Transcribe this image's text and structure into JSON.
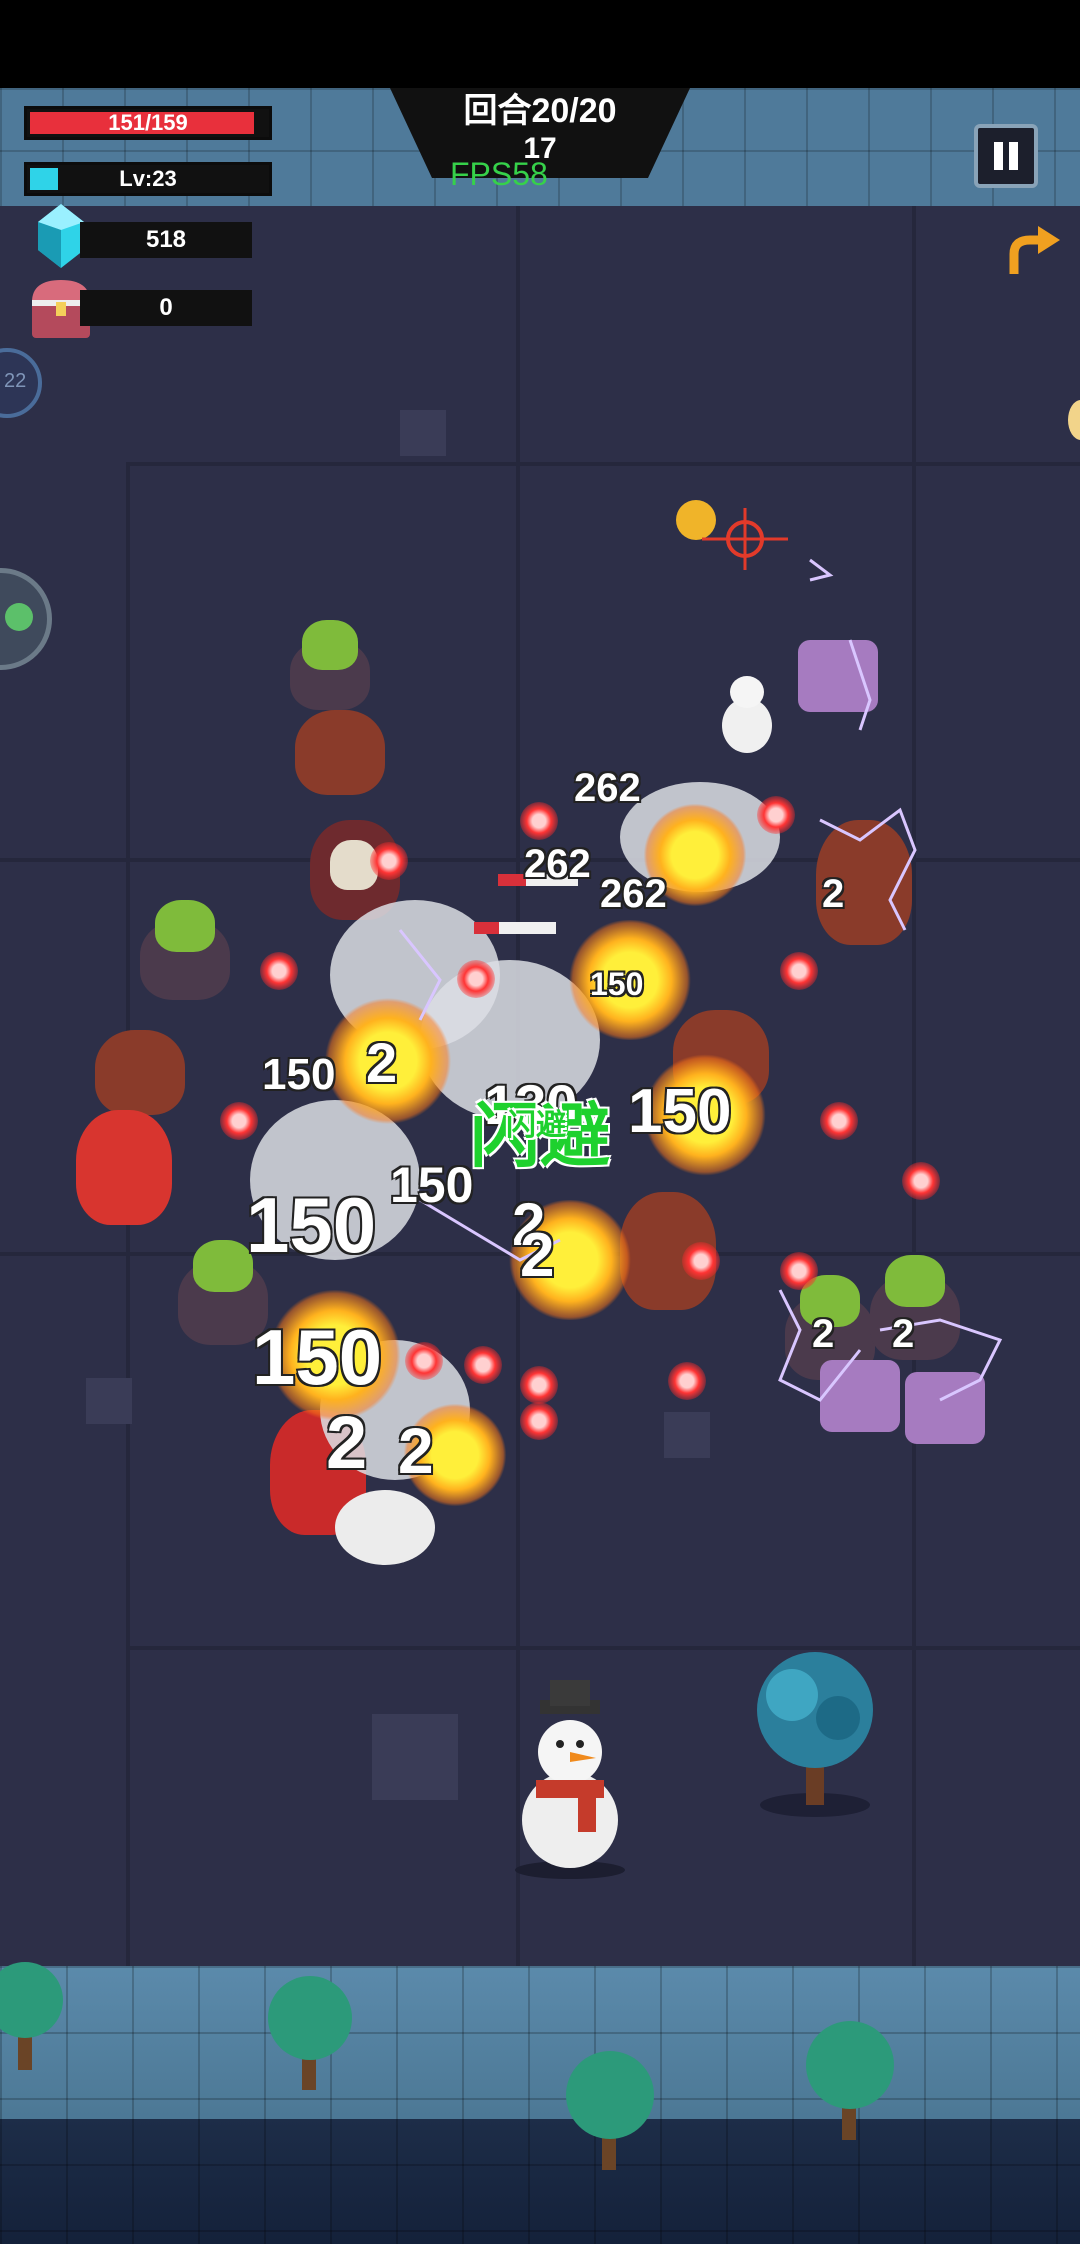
{
  "hud": {
    "hp_text": "151/159",
    "hp_fraction": 0.95,
    "level_text": "Lv:23",
    "xp_fraction": 0.12,
    "crystals": "518",
    "chests": "0",
    "round_text": "回合20/20",
    "timer": "17",
    "fps": "FPS58",
    "side_counter": "22"
  },
  "combat": {
    "damage_numbers": [
      "262",
      "262",
      "262",
      "150",
      "150",
      "150",
      "150",
      "150",
      "150",
      "2",
      "2",
      "2",
      "2",
      "2",
      "2",
      "2",
      "2",
      "130"
    ],
    "dodge_text": "闪避",
    "dodge_text_small": "闪避"
  },
  "colors": {
    "hp_bar": "#e8303c",
    "xp_bar": "#2fd3e8",
    "floor": "#2d2f48",
    "wall": "#4f7a9a",
    "dodge_green": "#1ed12e"
  },
  "icons": {
    "crystal": "crystal-icon",
    "chest": "treasure-chest-icon",
    "pause": "pause-icon",
    "back": "return-arrow-icon"
  }
}
